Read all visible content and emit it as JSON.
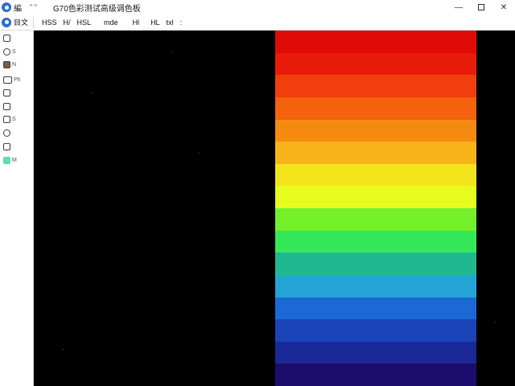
{
  "titlebar": {
    "app_label": "編 ",
    "marks": "\" \"",
    "title": "G70色彩测试高级调色板",
    "controls": {
      "minimize": "—",
      "close": "✕"
    }
  },
  "menu": {
    "file_label": "目文",
    "items": [
      "HSS",
      "H/",
      "HSL",
      "mde",
      "Hl",
      "HL",
      "txl",
      ":"
    ]
  },
  "tools": [
    {
      "label": ""
    },
    {
      "label": "S"
    },
    {
      "label": "N"
    },
    {
      "label": "Ph"
    },
    {
      "label": ""
    },
    {
      "label": ""
    },
    {
      "label": "S"
    },
    {
      "label": ""
    },
    {
      "label": ""
    },
    {
      "label": "M"
    }
  ],
  "swatch_color": "#5ee0a8",
  "colors": {
    "canvas": "#000000",
    "stripes": [
      "#e00a06",
      "#e81a0a",
      "#f03e0c",
      "#f4620e",
      "#f68a10",
      "#f8b41a",
      "#f4e41c",
      "#e6fc1e",
      "#74f02a",
      "#34e85a",
      "#20b890",
      "#24a4d4",
      "#1c68d4",
      "#1a44b8",
      "#1a2898",
      "#1c0c6c"
    ]
  }
}
